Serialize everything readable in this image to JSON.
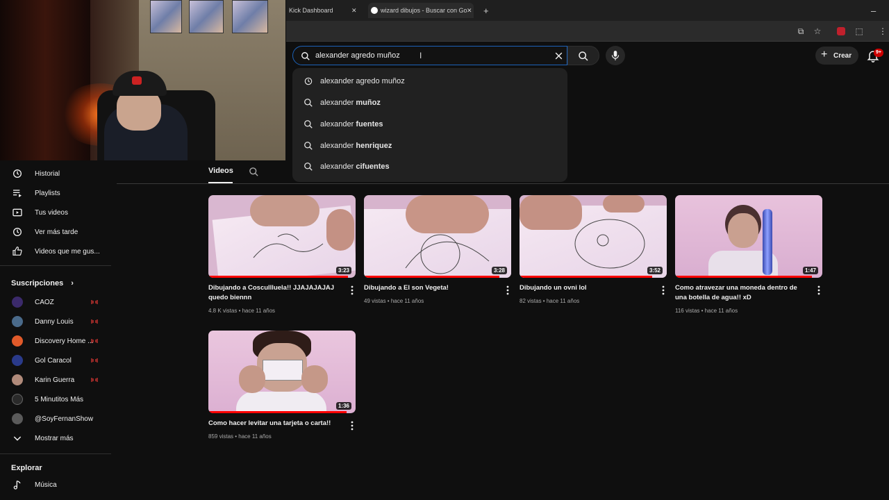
{
  "browser": {
    "tabs": [
      {
        "label": "Kick Dashboard"
      },
      {
        "label": "wizard dibujos - Buscar con Go"
      }
    ]
  },
  "search": {
    "value": "alexander agredo muñoz",
    "suggestions": [
      {
        "prefix": "alexander agredo muñoz",
        "bold": "",
        "icon": "history-icon"
      },
      {
        "prefix": "alexander ",
        "bold": "muñoz",
        "icon": "search-icon"
      },
      {
        "prefix": "alexander ",
        "bold": "fuentes",
        "icon": "search-icon"
      },
      {
        "prefix": "alexander ",
        "bold": "henriquez",
        "icon": "search-icon"
      },
      {
        "prefix": "alexander ",
        "bold": "cifuentes",
        "icon": "search-icon"
      }
    ]
  },
  "header": {
    "create_label": "Crear",
    "notif_badge": "9+"
  },
  "sidebar": {
    "you_items": [
      {
        "label": "Historial",
        "icon": "history-icon"
      },
      {
        "label": "Playlists",
        "icon": "playlists-icon"
      },
      {
        "label": "Tus videos",
        "icon": "your-videos-icon"
      },
      {
        "label": "Ver más tarde",
        "icon": "watch-later-icon"
      },
      {
        "label": "Videos que me gus...",
        "icon": "thumbs-up-icon"
      }
    ],
    "subs_title": "Suscripciones",
    "subscriptions": [
      {
        "label": "CAOZ",
        "live": true,
        "color": "#3b2a6b"
      },
      {
        "label": "Danny Louis",
        "live": true,
        "color": "#4a6a8a"
      },
      {
        "label": "Discovery Home ...",
        "live": true,
        "color": "#e05a2a"
      },
      {
        "label": "Gol Caracol",
        "live": true,
        "color": "#2a3a8a"
      },
      {
        "label": "Karin Guerra",
        "live": true,
        "color": "#b08a7a"
      },
      {
        "label": "5 Minutitos Más",
        "live": false,
        "color": "#2a2a2a"
      },
      {
        "label": "@SoyFernanShow",
        "live": false,
        "color": "#5a5a5a"
      }
    ],
    "show_more": "Mostrar más",
    "explore_title": "Explorar",
    "explore_items": [
      {
        "label": "Música",
        "icon": "music-icon"
      }
    ]
  },
  "channel": {
    "tab_label": "Videos"
  },
  "videos": [
    {
      "title": "Dibujando a Coscullluela!! JJAJAJAJAJ quedo biennn",
      "meta": "4.8 K vistas • hace 11 años",
      "duration": "3:23",
      "progress": 0.95
    },
    {
      "title": "Dibujando a El son Vegeta!",
      "meta": "49 vistas • hace 11 años",
      "duration": "3:28",
      "progress": 0.92
    },
    {
      "title": "Dibujando un ovni lol",
      "meta": "82 vistas • hace 11 años",
      "duration": "3:52",
      "progress": 0.9
    },
    {
      "title": "Como atravezar una moneda dentro de una botella de agua!! xD",
      "meta": "116 vistas • hace 11 años",
      "duration": "1:47",
      "progress": 0.93
    },
    {
      "title": "Como hacer levitar una tarjeta o carta!!",
      "meta": "859 vistas • hace 11 años",
      "duration": "1:36",
      "progress": 0.94
    }
  ]
}
